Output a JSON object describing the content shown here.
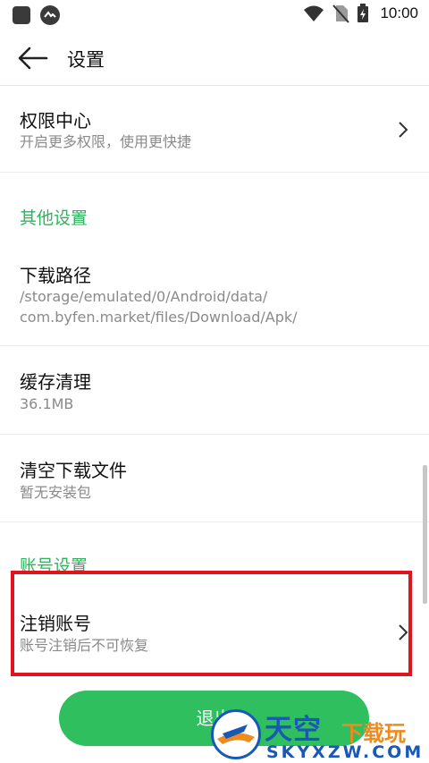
{
  "status_bar": {
    "time": "10:00",
    "icons": [
      "app-square-icon",
      "cloud-badge-icon",
      "wifi-icon",
      "no-sim-icon",
      "battery-charging-icon"
    ]
  },
  "header": {
    "title": "设置",
    "back_icon": "arrow-left-icon"
  },
  "rows": {
    "permissions": {
      "title": "权限中心",
      "subtitle": "开启更多权限，使用更快捷"
    },
    "download_path": {
      "title": "下载路径",
      "subtitle_line1": "/storage/emulated/0/Android/data/",
      "subtitle_line2": "com.byfen.market/files/Download/Apk/"
    },
    "cache": {
      "title": "缓存清理",
      "subtitle": "36.1MB"
    },
    "clear_downloads": {
      "title": "清空下载文件",
      "subtitle": "暂无安装包"
    },
    "cancel_account": {
      "title": "注销账号",
      "subtitle": "账号注销后不可恢复"
    }
  },
  "sections": {
    "other": "其他设置",
    "account": "账号设置"
  },
  "logout_button": "退出",
  "watermark": {
    "main": "天空",
    "sub": "下载玩",
    "domain": "SKYXZW.COM"
  },
  "colors": {
    "accent_green": "#2fb35e",
    "button_green": "#2fbf5f",
    "highlight_red": "#e0141e",
    "watermark_blue": "#1a58b8",
    "watermark_orange": "#f08a1c"
  }
}
